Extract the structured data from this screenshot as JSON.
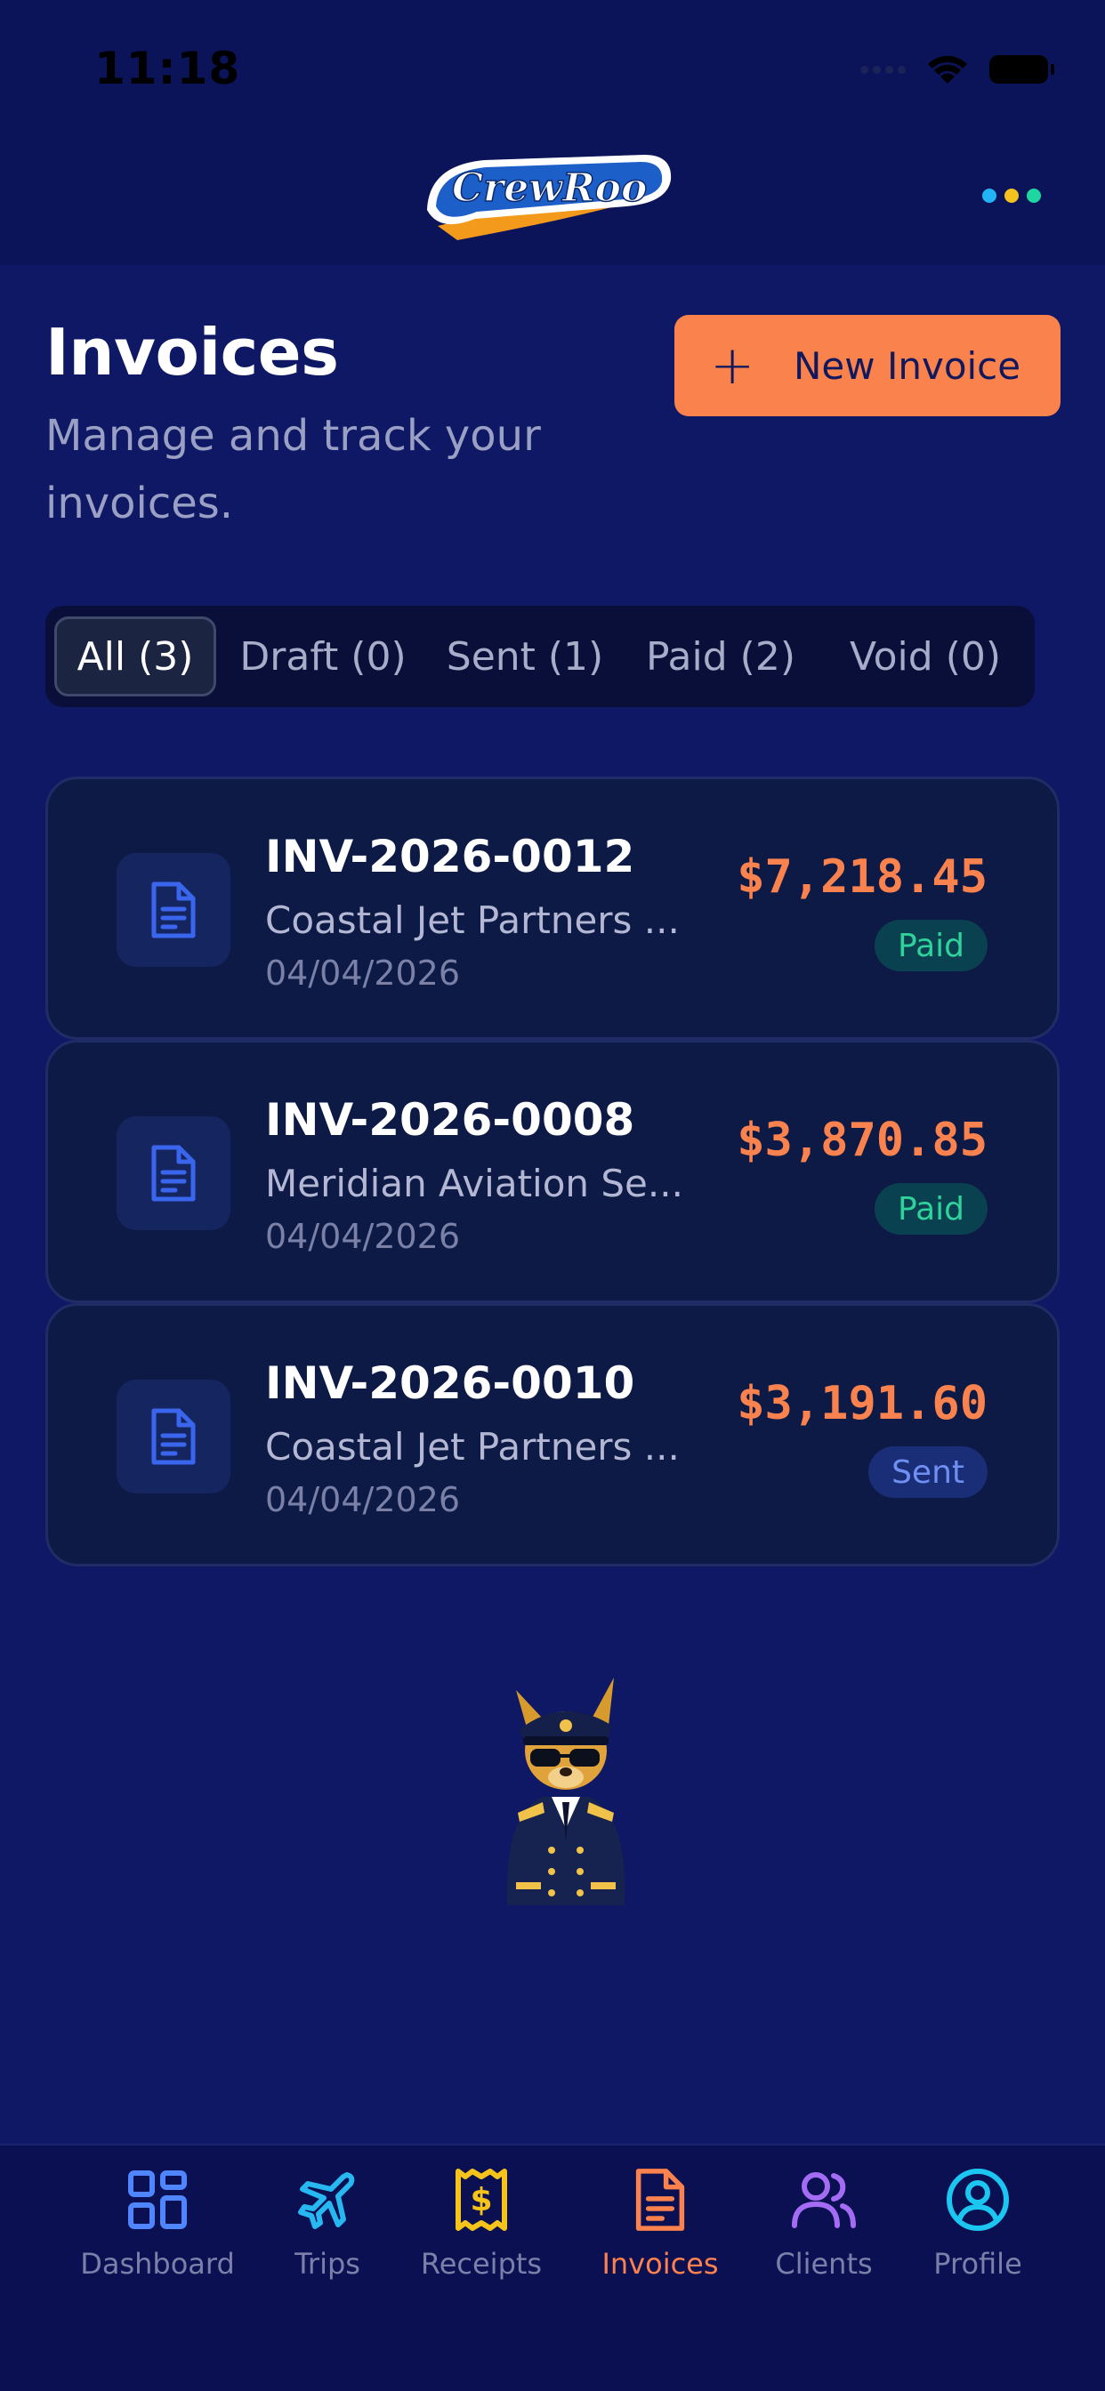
{
  "status_bar": {
    "time": "11:18"
  },
  "brand": {
    "logo_text": "CrewRoo",
    "menu_dot_colors": [
      "#22b4f5",
      "#f5c11f",
      "#1fd6a0"
    ]
  },
  "header": {
    "title": "Invoices",
    "subtitle": "Manage and track your invoices.",
    "new_invoice_label": "New Invoice",
    "new_invoice_icon": "plus-icon"
  },
  "filters": [
    {
      "label": "All (3)",
      "active": true
    },
    {
      "label": "Draft (0)",
      "active": false
    },
    {
      "label": "Sent (1)",
      "active": false
    },
    {
      "label": "Paid (2)",
      "active": false
    },
    {
      "label": "Void (0)",
      "active": false
    }
  ],
  "invoices": [
    {
      "number": "INV-2026-0012",
      "client": "Coastal Jet Partners ...",
      "date": "04/04/2026",
      "amount": "$7,218.45",
      "status": "Paid"
    },
    {
      "number": "INV-2026-0008",
      "client": "Meridian Aviation Se...",
      "date": "04/04/2026",
      "amount": "$3,870.85",
      "status": "Paid"
    },
    {
      "number": "INV-2026-0010",
      "client": "Coastal Jet Partners ...",
      "date": "04/04/2026",
      "amount": "$3,191.60",
      "status": "Sent"
    }
  ],
  "nav": [
    {
      "label": "Dashboard",
      "icon": "grid-icon",
      "color": "#4f86ff",
      "active": false
    },
    {
      "label": "Trips",
      "icon": "plane-icon",
      "color": "#27b8f2",
      "active": false
    },
    {
      "label": "Receipts",
      "icon": "receipt-icon",
      "color": "#f5c319",
      "active": false
    },
    {
      "label": "Invoices",
      "icon": "document-icon",
      "color": "#fb824c",
      "active": true
    },
    {
      "label": "Clients",
      "icon": "users-icon",
      "color": "#a46cf5",
      "active": false
    },
    {
      "label": "Profile",
      "icon": "user-circle-icon",
      "color": "#1bc6f0",
      "active": false
    }
  ],
  "colors": {
    "background": "#0e1865",
    "accent": "#fa824c",
    "card": "#0d1a45",
    "paid": "#2fd29b",
    "sent": "#6f8ff3"
  }
}
